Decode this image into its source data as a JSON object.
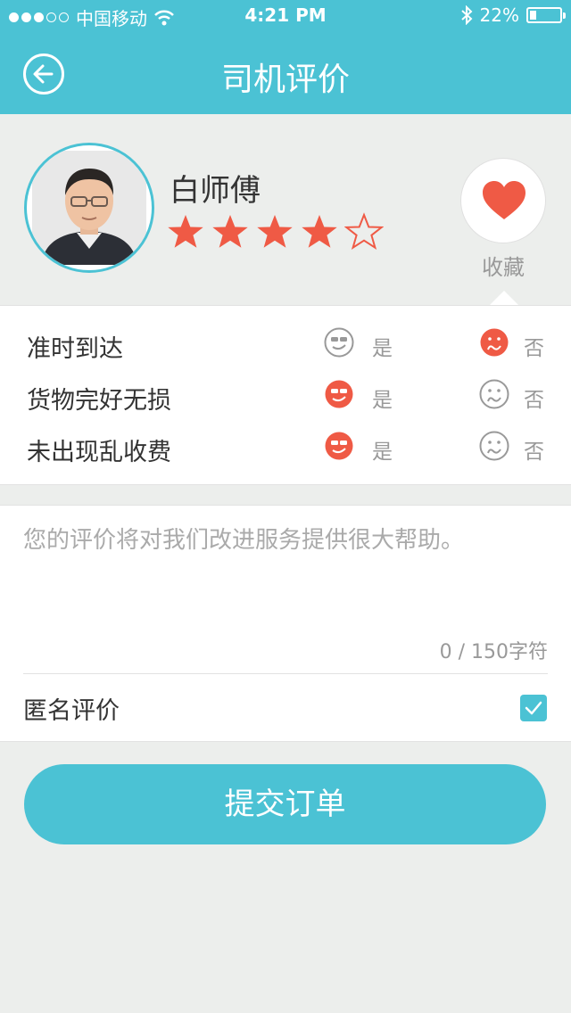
{
  "status_bar": {
    "carrier": "中国移动",
    "time": "4:21 PM",
    "battery_percent": "22%",
    "battery_level": 0.22,
    "signal_bars_filled": 3,
    "signal_bars_total": 5,
    "wifi_icon": "wifi-icon",
    "bluetooth_icon": "bluetooth-icon"
  },
  "nav": {
    "title": "司机评价",
    "back_icon": "arrow-left-circle-icon"
  },
  "driver": {
    "name": "白师傅",
    "rating": 4,
    "rating_max": 5,
    "favorite_label": "收藏",
    "favorite_icon": "heart-icon"
  },
  "ratings": {
    "yes_label": "是",
    "no_label": "否",
    "rows": [
      {
        "label": "准时到达",
        "selected": "no"
      },
      {
        "label": "货物完好无损",
        "selected": "yes"
      },
      {
        "label": "未出现乱收费",
        "selected": "yes"
      }
    ]
  },
  "comment": {
    "placeholder": "您的评价将对我们改进服务提供很大帮助。",
    "value": "",
    "counter": "0 / 150字符"
  },
  "anonymous": {
    "label": "匿名评价",
    "checked": true
  },
  "submit": {
    "label": "提交订单"
  },
  "colors": {
    "accent": "#4bc2d4",
    "highlight": "#ef5a45",
    "inactive": "#999999",
    "background": "#eceeec"
  }
}
